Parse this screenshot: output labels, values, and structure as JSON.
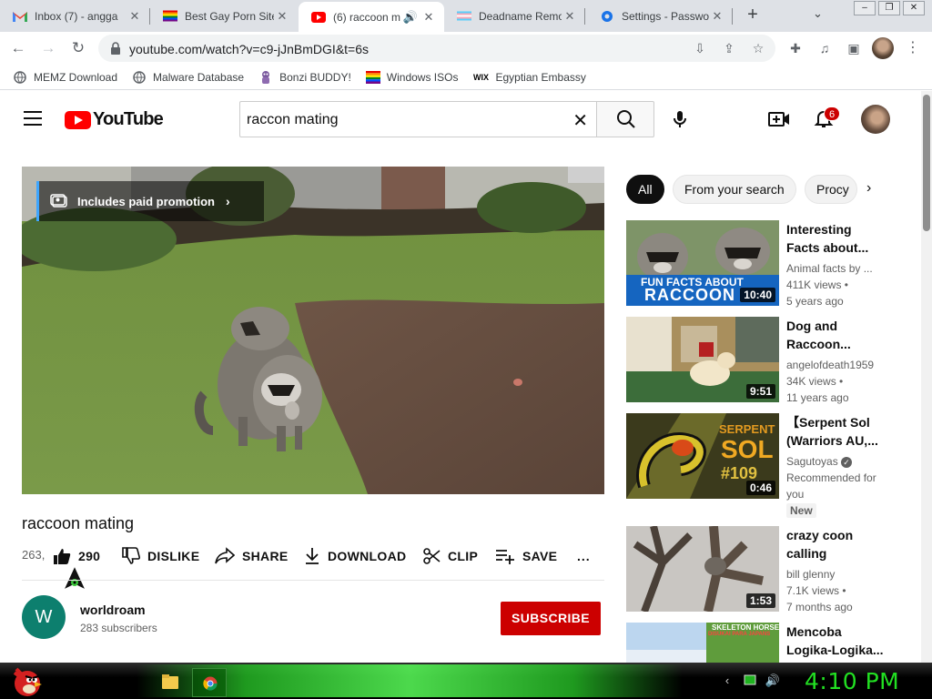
{
  "browser": {
    "tabs": [
      {
        "title": "Inbox (7) - angga",
        "icon": "gmail-icon"
      },
      {
        "title": "Best Gay Porn Site",
        "icon": "rainbow-flag-icon"
      },
      {
        "title": "(6) raccoon m",
        "icon": "youtube-icon",
        "active": true
      },
      {
        "title": "Deadname Remo",
        "icon": "trans-flag-icon"
      },
      {
        "title": "Settings - Passwo",
        "icon": "gear-icon"
      }
    ],
    "url": "youtube.com/watch?v=c9-jJnBmDGI&t=6s",
    "bookmarks": [
      {
        "label": "MEMZ Download",
        "icon": "globe-icon"
      },
      {
        "label": "Malware Database",
        "icon": "globe-icon"
      },
      {
        "label": "Bonzi BUDDY!",
        "icon": "bonzi-icon"
      },
      {
        "label": "Windows ISOs",
        "icon": "windows-icon"
      },
      {
        "label": "Egyptian Embassy",
        "icon": "wix-icon"
      }
    ]
  },
  "youtube": {
    "logo_text": "YouTube",
    "search_query": "raccon mating",
    "notifications_count": "6",
    "video": {
      "promo_text": "Includes paid promotion",
      "title": "raccoon mating",
      "views": "263,",
      "likes": "290",
      "dislike_label": "DISLIKE",
      "share_label": "SHARE",
      "download_label": "DOWNLOAD",
      "clip_label": "CLIP",
      "save_label": "SAVE",
      "more_label": "..."
    },
    "channel": {
      "initial": "W",
      "name": "worldroam",
      "subscribers": "283 subscribers",
      "subscribe_label": "SUBSCRIBE"
    },
    "chips": [
      "All",
      "From your search",
      "Procy"
    ],
    "recommendations": [
      {
        "title_l1": "Interesting",
        "title_l2": "Facts about...",
        "channel": "Animal facts by ...",
        "views": "411K views •",
        "age": "5 years ago",
        "duration": "10:40",
        "thumb_text_1": "FUN FACTS ABOUT",
        "thumb_text_2": "RACCOON"
      },
      {
        "title_l1": "Dog and",
        "title_l2": "Raccoon...",
        "channel": "angelofdeath1959",
        "views": "34K views •",
        "age": "11 years ago",
        "duration": "9:51"
      },
      {
        "title_l1": "【Serpent Sol",
        "title_l2": "(Warriors AU,...",
        "channel": "Sagutoyas",
        "views": "Recommended for",
        "age": "you",
        "duration": "0:46",
        "badge": "New",
        "thumb_text_1": "SERPENT",
        "thumb_text_2": "SOL",
        "thumb_text_3": "#109"
      },
      {
        "title_l1": "crazy coon",
        "title_l2": "calling",
        "channel": "bill glenny",
        "views": "7.1K views •",
        "age": "7 months ago",
        "duration": "1:53"
      },
      {
        "title_l1": "Mencoba",
        "title_l2": "Logika-Logika...",
        "thumb_text_1": "SKELETON HORSE",
        "thumb_text_2": "DISUKAI PARA JAPANS"
      }
    ]
  },
  "taskbar": {
    "clock": "4:10 PM"
  },
  "colors": {
    "yt_red": "#ff0000",
    "subscribe_red": "#cc0000",
    "taskbar_green": "#22e022"
  }
}
